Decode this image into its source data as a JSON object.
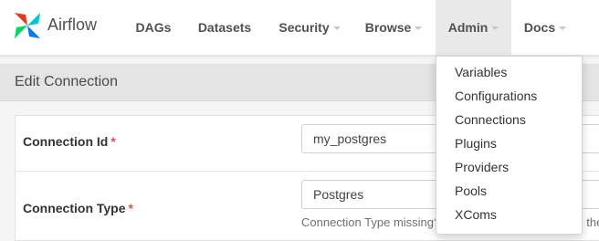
{
  "brand": {
    "name": "Airflow",
    "icon": "airflow-pinwheel-icon"
  },
  "nav": {
    "items": [
      {
        "label": "DAGs",
        "has_dropdown": false
      },
      {
        "label": "Datasets",
        "has_dropdown": false
      },
      {
        "label": "Security",
        "has_dropdown": true
      },
      {
        "label": "Browse",
        "has_dropdown": true
      },
      {
        "label": "Admin",
        "has_dropdown": true,
        "active": true
      },
      {
        "label": "Docs",
        "has_dropdown": true
      }
    ]
  },
  "admin_menu": {
    "items": [
      "Variables",
      "Configurations",
      "Connections",
      "Plugins",
      "Providers",
      "Pools",
      "XComs"
    ]
  },
  "panel": {
    "title": "Edit Connection"
  },
  "form": {
    "connection_id": {
      "label": "Connection Id",
      "required_mark": "*",
      "value": "my_postgres"
    },
    "connection_type": {
      "label": "Connection Type",
      "required_mark": "*",
      "value": "Postgres",
      "help": "Connection Type missing? Make sure you've installed the corresponding Airflow Provider Package."
    }
  },
  "colors": {
    "accent_red": "#d9534f",
    "nav_active_bg": "#e9e9e9",
    "panel_header_bg": "#e4e4e4"
  }
}
